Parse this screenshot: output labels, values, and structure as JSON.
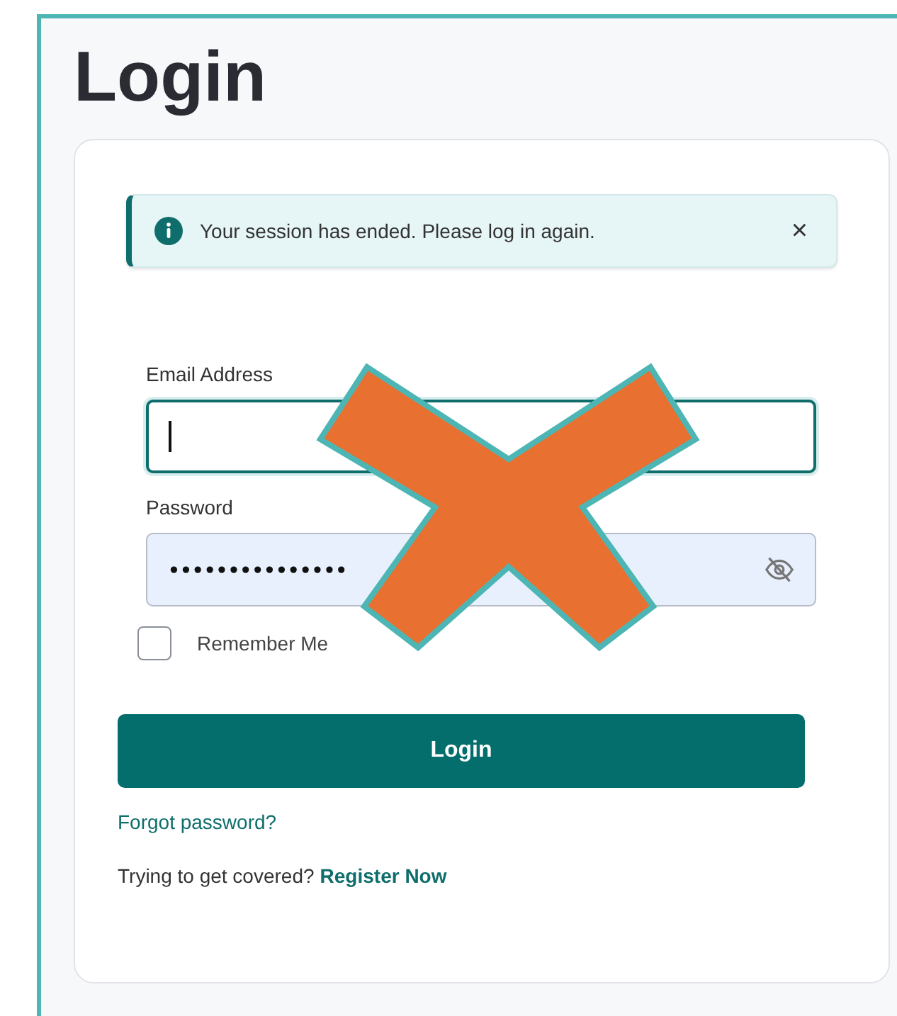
{
  "page": {
    "title": "Login"
  },
  "alert": {
    "message": "Your session has ended. Please log in again.",
    "close": "×"
  },
  "form": {
    "email": {
      "label": "Email Address",
      "focused": true
    },
    "password": {
      "label": "Password",
      "value": "•••••••••••••••",
      "revealed": false
    },
    "remember": {
      "label": "Remember Me",
      "checked": false
    },
    "submit": "Login",
    "forgot": "Forgot password?",
    "register_prompt": "Trying to get covered?",
    "register_link": "Register Now"
  },
  "overlay": {
    "cross_mark": true
  }
}
